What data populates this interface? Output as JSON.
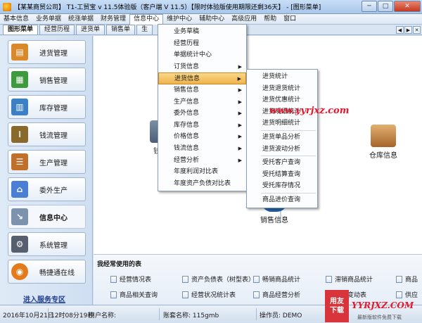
{
  "window": {
    "title": "【某某商贸公司】 T1-工贸宝 v 11.5体验版（客户端 V 11.5）【限时体验版使用期限还剩36天】 - [图形菜单]",
    "minimize": "─",
    "maximize": "□",
    "close": "✕"
  },
  "menubar": {
    "items": [
      "基本信息",
      "业务单据",
      "统涨单据",
      "财务管理",
      "信息中心",
      "维护中心",
      "辅助中心",
      "高级应用",
      "帮助",
      "窗口"
    ]
  },
  "tabs": {
    "items": [
      "图形菜单",
      "经营历程",
      "进货单",
      "销售单",
      "生"
    ],
    "active": 0
  },
  "sidebar": {
    "items": [
      {
        "label": "进货管理",
        "icon": "basket-icon",
        "color": "#d9892a"
      },
      {
        "label": "销售管理",
        "icon": "cart-icon",
        "color": "#3d9a3d"
      },
      {
        "label": "库存管理",
        "icon": "warehouse-grid-icon",
        "color": "#3d7fc4"
      },
      {
        "label": "钱流管理",
        "icon": "abacus-icon",
        "color": "#8a6a2a"
      },
      {
        "label": "生产管理",
        "icon": "drawer-icon",
        "color": "#c0702a"
      },
      {
        "label": "委外生产",
        "icon": "house-icon",
        "color": "#4a7fd4"
      },
      {
        "label": "信息中心",
        "icon": "chart-doc-icon",
        "color": "#7d93ad"
      },
      {
        "label": "系统管理",
        "icon": "gear-sliders-icon",
        "color": "#555f6e"
      },
      {
        "label": "畅捷通在线",
        "icon": "globe-icon",
        "color": "#e37b1d"
      }
    ],
    "service_link": "进入服务专区"
  },
  "flow": {
    "left_partial_label": "钱",
    "sales_info": "销售信息",
    "warehouse_info": "仓库信息"
  },
  "info_menu": {
    "items": [
      {
        "label": "业务草稿",
        "submenu": false
      },
      {
        "label": "经营历程",
        "submenu": false
      },
      {
        "label": "单据统计中心",
        "submenu": false
      },
      {
        "label": "订货信息",
        "submenu": true
      },
      {
        "label": "进货信息",
        "submenu": true,
        "highlight": true
      },
      {
        "label": "销售信息",
        "submenu": true
      },
      {
        "label": "生产信息",
        "submenu": true
      },
      {
        "label": "委外信息",
        "submenu": true
      },
      {
        "label": "库存信息",
        "submenu": true
      },
      {
        "label": "价格信息",
        "submenu": true
      },
      {
        "label": "钱流信息",
        "submenu": true
      },
      {
        "label": "经营分析",
        "submenu": true
      },
      {
        "label": "年度利润对比表",
        "submenu": false
      },
      {
        "label": "年度资产负债对比表",
        "submenu": false
      }
    ]
  },
  "purchase_submenu": {
    "items": [
      "进货统计",
      "进货退货统计",
      "进货优惠统计",
      "进货明细统计",
      "进货明细统计",
      "进货单品分析",
      "进货波动分析",
      "受托客户查询",
      "受托结算查询",
      "受托库存情况",
      "商品进价查询"
    ]
  },
  "frequent_tables": {
    "title": "我经常使用的表",
    "row1": [
      "经营情况表",
      "资产负债表（树型表）",
      "畅销商品统计",
      "滞销商品统计",
      "商品"
    ],
    "row2": [
      "商品相关查询",
      "经营状况统计表",
      "商品经营分析",
      "进销变动表",
      "供应"
    ]
  },
  "status": {
    "date": "2016年10月21日",
    "time": "12时08分19秒",
    "user_label": "用户名称:",
    "account_label": "账套名称: 115gmb",
    "operator_label": "操作员: DEMO"
  },
  "watermarks": {
    "center": "www.yyrjxz.com",
    "stamp_top": "用友",
    "stamp_bottom": "下载",
    "site": "YYRJXZ.COM",
    "site_small": "最新版软件免费下载"
  }
}
